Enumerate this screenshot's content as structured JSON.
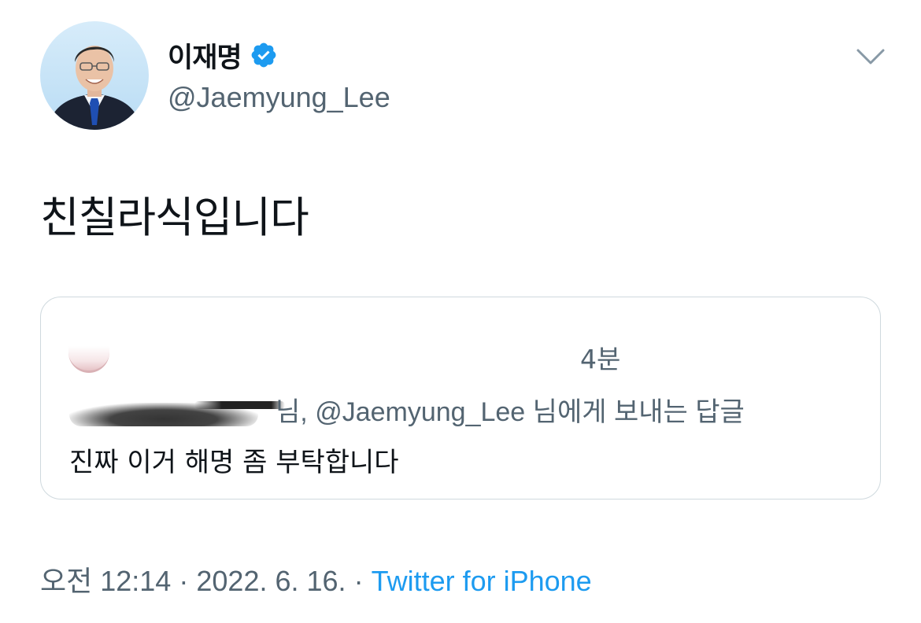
{
  "author": {
    "display_name": "이재명",
    "handle": "@Jaemyung_Lee",
    "verified": true
  },
  "tweet": {
    "text": "친칠라식입니다"
  },
  "quoted_tweet": {
    "time": "4분",
    "reply_prefix": "님,",
    "reply_handle": "@Jaemyung_Lee",
    "reply_suffix": "님에게 보내는 답글",
    "text": "진짜 이거 해명 좀 부탁합니다"
  },
  "meta": {
    "time": "오전 12:14",
    "separator": "·",
    "date": "2022. 6. 16.",
    "source": "Twitter for iPhone"
  },
  "colors": {
    "text": "#0f1419",
    "secondary": "#536471",
    "accent": "#1d9bf0",
    "border": "#cfd9de"
  },
  "icons": {
    "verified": "verified-badge-icon",
    "menu": "chevron-down-icon"
  }
}
